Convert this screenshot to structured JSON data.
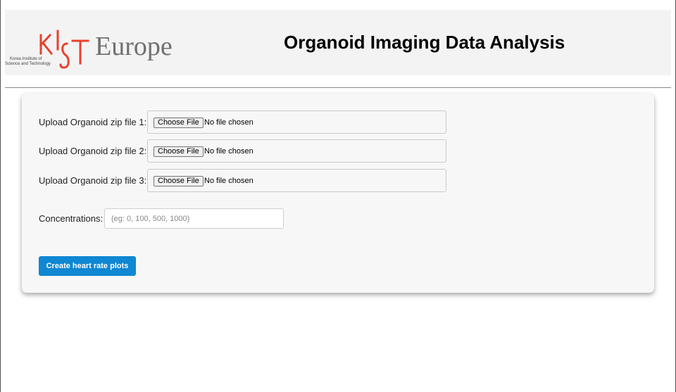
{
  "header": {
    "logo": {
      "mark": "KIST",
      "wordmark": "Europe",
      "tagline_line1": "Korea Institute of",
      "tagline_line2": "Science and Technology",
      "mark_color": "#e8412c",
      "wordmark_color": "#707070"
    },
    "title": "Organoid Imaging Data Analysis"
  },
  "form": {
    "uploads": [
      {
        "label": "Upload Organoid zip file 1:",
        "button": "Choose File",
        "status": "No file chosen"
      },
      {
        "label": "Upload Organoid zip file 2:",
        "button": "Choose File",
        "status": "No file chosen"
      },
      {
        "label": "Upload Organoid zip file 3:",
        "button": "Choose File",
        "status": "No file chosen"
      }
    ],
    "concentrations": {
      "label": "Concentrations:",
      "placeholder": "(eg: 0, 100, 500, 1000)",
      "value": ""
    },
    "submit_label": "Create heart rate plots",
    "accent_color": "#0f87d3"
  }
}
